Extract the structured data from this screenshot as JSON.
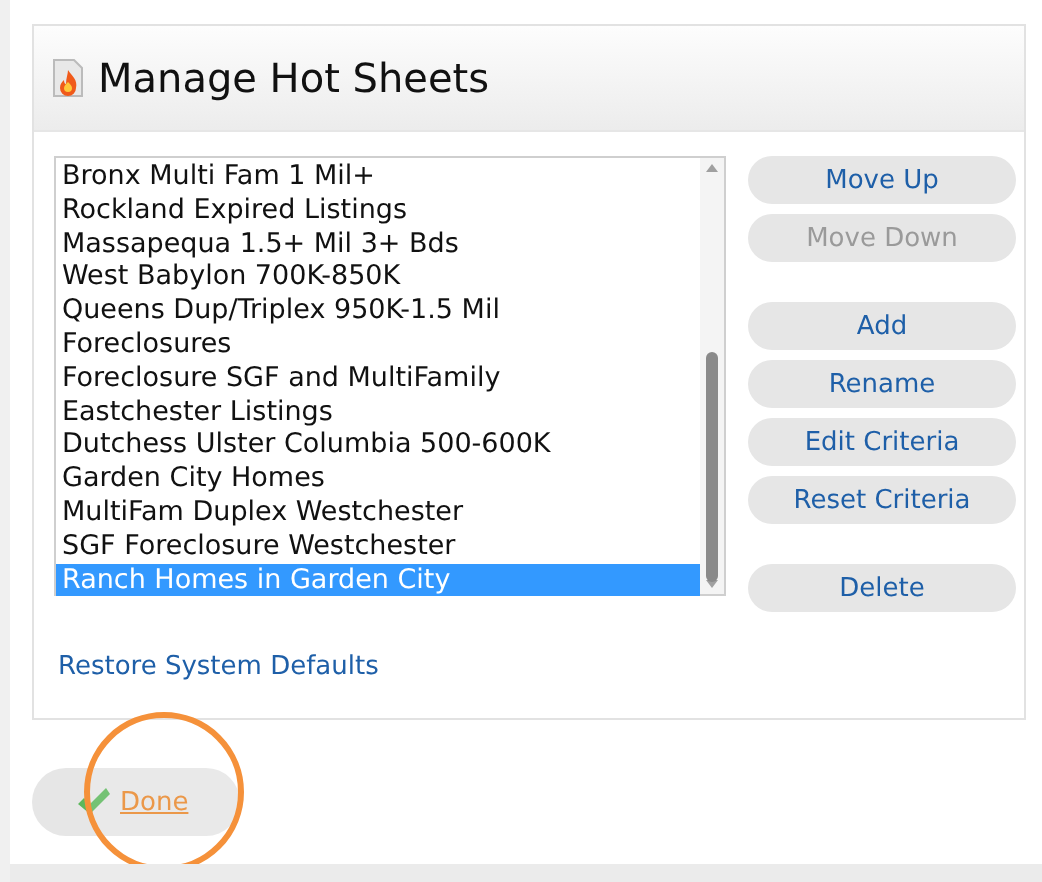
{
  "title": "Manage Hot Sheets",
  "hot_sheets": [
    {
      "label": "Bronx Multi Fam 1 Mil+",
      "selected": false
    },
    {
      "label": "Rockland Expired Listings",
      "selected": false
    },
    {
      "label": "Massapequa 1.5+ Mil 3+ Bds",
      "selected": false
    },
    {
      "label": "West Babylon 700K-850K",
      "selected": false
    },
    {
      "label": "Queens Dup/Triplex 950K-1.5 Mil",
      "selected": false
    },
    {
      "label": "Foreclosures",
      "selected": false
    },
    {
      "label": "Foreclosure SGF and MultiFamily",
      "selected": false
    },
    {
      "label": "Eastchester Listings",
      "selected": false
    },
    {
      "label": "Dutchess Ulster Columbia 500-600K",
      "selected": false
    },
    {
      "label": "Garden City Homes",
      "selected": false
    },
    {
      "label": "MultiFam Duplex Westchester",
      "selected": false
    },
    {
      "label": "SGF Foreclosure Westchester",
      "selected": false
    },
    {
      "label": "Ranch Homes in Garden City",
      "selected": true
    }
  ],
  "button_groups": [
    [
      {
        "label": "Move Up",
        "disabled": false
      },
      {
        "label": "Move Down",
        "disabled": true
      }
    ],
    [
      {
        "label": "Add",
        "disabled": false
      },
      {
        "label": "Rename",
        "disabled": false
      },
      {
        "label": "Edit Criteria",
        "disabled": false
      },
      {
        "label": "Reset Criteria",
        "disabled": false
      }
    ],
    [
      {
        "label": "Delete",
        "disabled": false
      }
    ]
  ],
  "restore_link": "Restore System Defaults",
  "done_button": "Done"
}
